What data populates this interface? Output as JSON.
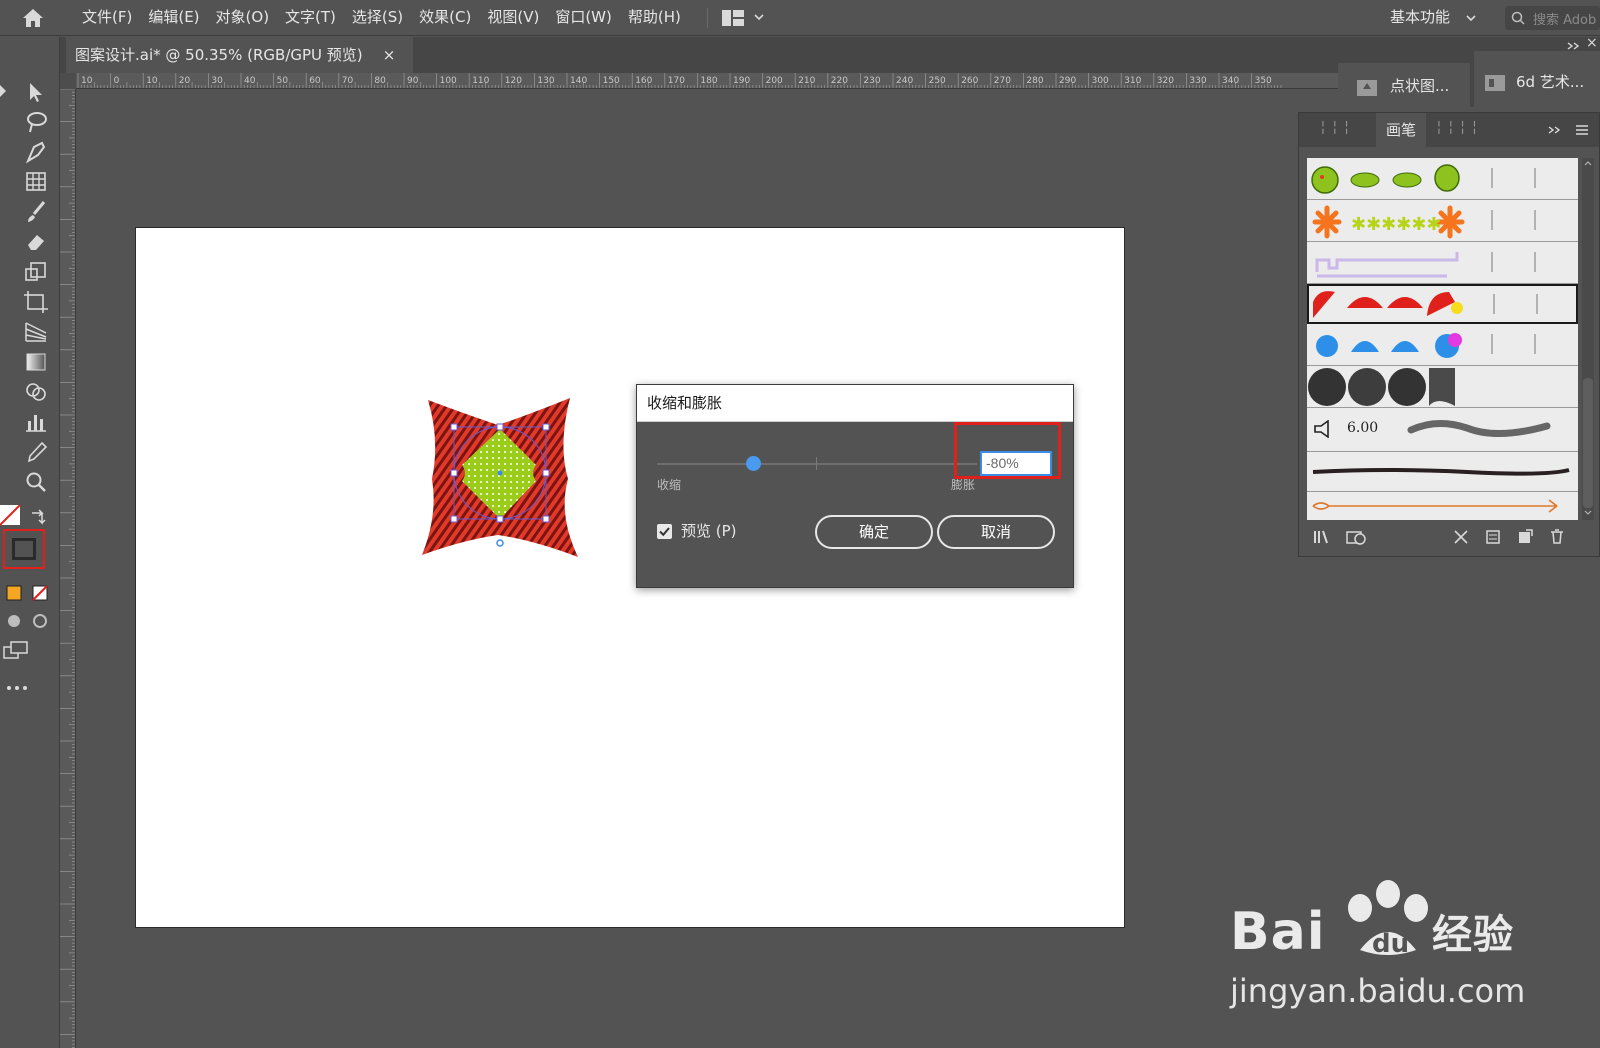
{
  "menubar": {
    "items": [
      "文件(F)",
      "编辑(E)",
      "对象(O)",
      "文字(T)",
      "选择(S)",
      "效果(C)",
      "视图(V)",
      "窗口(W)",
      "帮助(H)"
    ],
    "workspace": "基本功能",
    "search_placeholder": "搜索 Adob"
  },
  "document": {
    "tab_title": "图案设计.ai* @ 50.35% (RGB/GPU 预览)",
    "close": "×"
  },
  "ruler": {
    "h_labels": [
      "10",
      "0",
      "10",
      "20",
      "30",
      "40",
      "50",
      "60",
      "70",
      "80",
      "90",
      "100",
      "110",
      "120",
      "130",
      "140",
      "150",
      "160",
      "170",
      "180",
      "190",
      "200",
      "210",
      "220",
      "230",
      "240",
      "250",
      "260",
      "270",
      "280",
      "290",
      "300",
      "310",
      "320",
      "330",
      "340",
      "350"
    ]
  },
  "dialog": {
    "title": "收缩和膨胀",
    "label_left": "收缩",
    "label_right": "膨胀",
    "value": "-80%",
    "slider_value": -80,
    "preview_label": "预览 (P)",
    "preview_checked": true,
    "ok_label": "确定",
    "cancel_label": "取消"
  },
  "panels": {
    "mini1_label": "点状图...",
    "mini2_label": "6d 艺术...",
    "brushes_tab": "画笔",
    "brush_size_value": "6.00"
  },
  "colors": {
    "accent": "#4a9af0",
    "highlight": "#e0201b",
    "shape_red": "#e23a2a",
    "shape_green": "#9ccc1a"
  },
  "watermark": {
    "logo_text": "Bai",
    "logo_suffix": "经验",
    "url": "jingyan.baidu.com"
  }
}
